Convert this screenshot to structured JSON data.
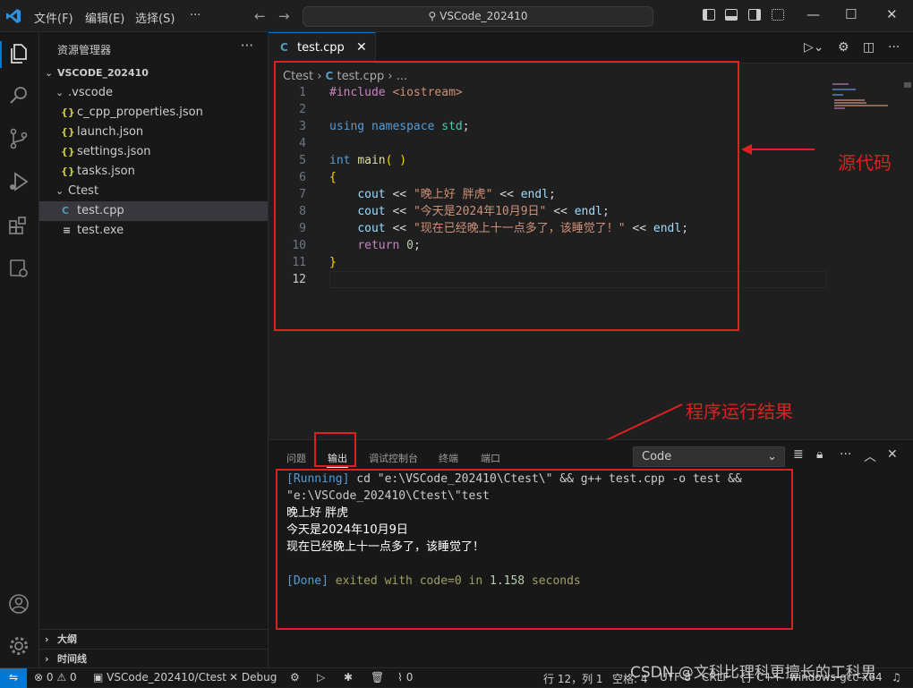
{
  "titlebar": {
    "menus": [
      "文件(F)",
      "编辑(E)",
      "选择(S)",
      "···"
    ],
    "search": "VSCode_202410"
  },
  "sidebar": {
    "title": "资源管理器",
    "more": "···",
    "root": "VSCODE_202410",
    "items": [
      {
        "label": ".vscode",
        "type": "folder"
      },
      {
        "label": "c_cpp_properties.json",
        "type": "json"
      },
      {
        "label": "launch.json",
        "type": "json"
      },
      {
        "label": "settings.json",
        "type": "json"
      },
      {
        "label": "tasks.json",
        "type": "json"
      },
      {
        "label": "Ctest",
        "type": "folder"
      },
      {
        "label": "test.cpp",
        "type": "cpp"
      },
      {
        "label": "test.exe",
        "type": "exe"
      }
    ],
    "outline": "大纲",
    "timeline": "时间线"
  },
  "editor": {
    "tab_label": "test.cpp",
    "breadcrumb": {
      "folder": "Ctest",
      "file": "test.cpp",
      "tail": "..."
    },
    "line_numbers": [
      "1",
      "2",
      "3",
      "4",
      "5",
      "6",
      "7",
      "8",
      "9",
      "10",
      "11",
      "12"
    ],
    "code": {
      "l1_pp": "#include",
      "l1_inc": "<iostream>",
      "l3_kw": "using",
      "l3_ns_kw": "namespace",
      "l3_ns": "std",
      "l5_type": "int",
      "l5_fn": "main",
      "l7_str": "\"晚上好 胖虎\"",
      "l8_str": "\"今天是2024年10月9日\"",
      "l9_str": "\"现在已经晚上十一点多了，该睡觉了！\"",
      "cout": "cout",
      "endl": "endl",
      "ret": "return",
      "zero": "0"
    }
  },
  "annotations": {
    "source_code": "源代码",
    "run_result": "程序运行结果"
  },
  "panel": {
    "tabs": [
      "问题",
      "输出",
      "调试控制台",
      "终端",
      "端口"
    ],
    "active_tab": "输出",
    "select_value": "Code",
    "output": {
      "running_tag": "[Running]",
      "cmd1": " cd \"e:\\VSCode_202410\\Ctest\\\" && g++ test.cpp -o test &&",
      "cmd2": "\"e:\\VSCode_202410\\Ctest\\\"test",
      "out1": "晚上好 胖虎",
      "out2": "今天是2024年10月9日",
      "out3": "现在已经晚上十一点多了，该睡觉了！",
      "done_tag": "[Done]",
      "done_text1": " exited with ",
      "done_code": "code=0",
      "done_in": " in ",
      "done_secs": "1.158",
      "done_seconds_word": " seconds"
    }
  },
  "statusbar": {
    "errors": "0",
    "warnings": "0",
    "workspace": "VSCode_202410/Ctest",
    "debug": "Debug",
    "ports": "0",
    "position": "行 12，列 1",
    "indent": "空格: 4",
    "encoding": "UTF-8",
    "eol": "CRLF",
    "lang": "C++",
    "config": "windows-gcc-x64"
  },
  "watermark": "CSDN @文科比理科更擅长的工科男",
  "colors": {
    "accent": "#0078d4",
    "annotation": "#e02020"
  }
}
